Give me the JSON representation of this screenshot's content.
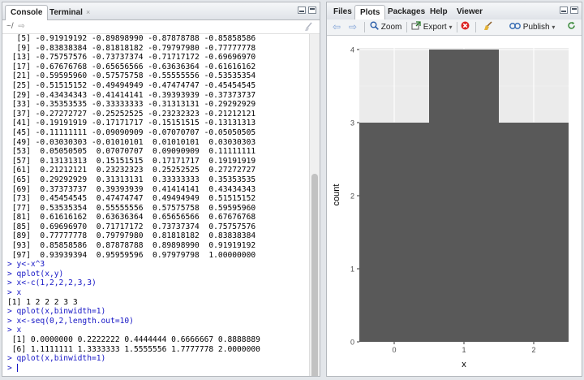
{
  "left_pane": {
    "tabs": [
      {
        "label": "Console"
      },
      {
        "label": "Terminal"
      }
    ],
    "close_glyph": "×",
    "path": "~/",
    "console_lines": [
      {
        "text": "  [5] -0.91919192 -0.89898990 -0.87878788 -0.85858586",
        "kind": "out"
      },
      {
        "text": "  [9] -0.83838384 -0.81818182 -0.79797980 -0.77777778",
        "kind": "out"
      },
      {
        "text": " [13] -0.75757576 -0.73737374 -0.71717172 -0.69696970",
        "kind": "out"
      },
      {
        "text": " [17] -0.67676768 -0.65656566 -0.63636364 -0.61616162",
        "kind": "out"
      },
      {
        "text": " [21] -0.59595960 -0.57575758 -0.55555556 -0.53535354",
        "kind": "out"
      },
      {
        "text": " [25] -0.51515152 -0.49494949 -0.47474747 -0.45454545",
        "kind": "out"
      },
      {
        "text": " [29] -0.43434343 -0.41414141 -0.39393939 -0.37373737",
        "kind": "out"
      },
      {
        "text": " [33] -0.35353535 -0.33333333 -0.31313131 -0.29292929",
        "kind": "out"
      },
      {
        "text": " [37] -0.27272727 -0.25252525 -0.23232323 -0.21212121",
        "kind": "out"
      },
      {
        "text": " [41] -0.19191919 -0.17171717 -0.15151515 -0.13131313",
        "kind": "out"
      },
      {
        "text": " [45] -0.11111111 -0.09090909 -0.07070707 -0.05050505",
        "kind": "out"
      },
      {
        "text": " [49] -0.03030303 -0.01010101  0.01010101  0.03030303",
        "kind": "out"
      },
      {
        "text": " [53]  0.05050505  0.07070707  0.09090909  0.11111111",
        "kind": "out"
      },
      {
        "text": " [57]  0.13131313  0.15151515  0.17171717  0.19191919",
        "kind": "out"
      },
      {
        "text": " [61]  0.21212121  0.23232323  0.25252525  0.27272727",
        "kind": "out"
      },
      {
        "text": " [65]  0.29292929  0.31313131  0.33333333  0.35353535",
        "kind": "out"
      },
      {
        "text": " [69]  0.37373737  0.39393939  0.41414141  0.43434343",
        "kind": "out"
      },
      {
        "text": " [73]  0.45454545  0.47474747  0.49494949  0.51515152",
        "kind": "out"
      },
      {
        "text": " [77]  0.53535354  0.55555556  0.57575758  0.59595960",
        "kind": "out"
      },
      {
        "text": " [81]  0.61616162  0.63636364  0.65656566  0.67676768",
        "kind": "out"
      },
      {
        "text": " [85]  0.69696970  0.71717172  0.73737374  0.75757576",
        "kind": "out"
      },
      {
        "text": " [89]  0.77777778  0.79797980  0.81818182  0.83838384",
        "kind": "out"
      },
      {
        "text": " [93]  0.85858586  0.87878788  0.89898990  0.91919192",
        "kind": "out"
      },
      {
        "text": " [97]  0.93939394  0.95959596  0.97979798  1.00000000",
        "kind": "out"
      },
      {
        "text": "> y<-x^3",
        "kind": "cmd"
      },
      {
        "text": "> qplot(x,y)",
        "kind": "cmd"
      },
      {
        "text": "> x<-c(1,2,2,2,3,3)",
        "kind": "cmd"
      },
      {
        "text": "> x",
        "kind": "cmd"
      },
      {
        "text": "[1] 1 2 2 2 3 3",
        "kind": "out"
      },
      {
        "text": "> qplot(x,binwidth=1)",
        "kind": "cmd"
      },
      {
        "text": "> x<-seq(0,2,length.out=10)",
        "kind": "cmd"
      },
      {
        "text": "> x",
        "kind": "cmd"
      },
      {
        "text": " [1] 0.0000000 0.2222222 0.4444444 0.6666667 0.8888889",
        "kind": "out"
      },
      {
        "text": " [6] 1.1111111 1.3333333 1.5555556 1.7777778 2.0000000",
        "kind": "out"
      },
      {
        "text": "> qplot(x,binwidth=1)",
        "kind": "cmd"
      }
    ],
    "prompt": "> "
  },
  "right_pane": {
    "tabs": [
      {
        "label": "Files"
      },
      {
        "label": "Plots"
      },
      {
        "label": "Packages"
      },
      {
        "label": "Help"
      },
      {
        "label": "Viewer"
      }
    ],
    "toolbar": {
      "zoom": "Zoom",
      "export": "Export",
      "publish": "Publish"
    }
  },
  "colors": {
    "bar": "#595959",
    "panel": "#ebebeb",
    "grid_major": "#ffffff",
    "grid_minor": "#f4f4f4",
    "command": "#1515c5"
  },
  "chart_data": {
    "type": "bar",
    "categories": [
      0,
      1,
      2
    ],
    "values": [
      3,
      4,
      3
    ],
    "xlabel": "x",
    "ylabel": "count",
    "xticks": [
      "0",
      "1",
      "2"
    ],
    "yticks": [
      "0",
      "1",
      "2",
      "3",
      "4"
    ],
    "xlim": [
      -0.5,
      2.5
    ],
    "ylim": [
      0,
      4
    ],
    "grid": true,
    "legend": "none"
  }
}
